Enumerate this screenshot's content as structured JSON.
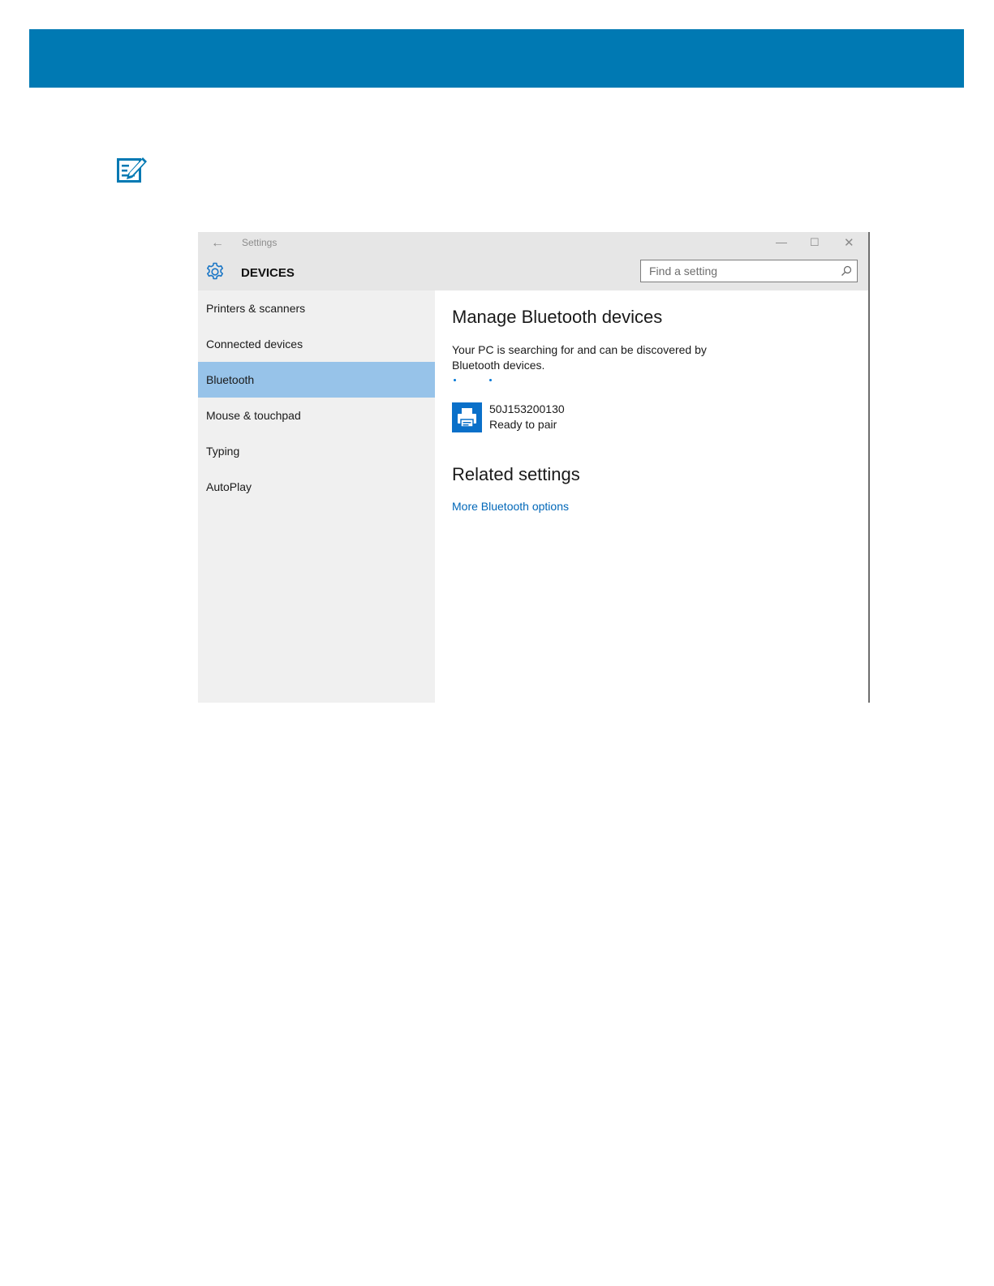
{
  "colors": {
    "header_bar": "#0079b3",
    "selected_nav": "#97c3e9",
    "link": "#0067b8",
    "sidebar_bg": "#f0f0f0",
    "titlebar_bg": "#e6e6e6"
  },
  "note": {
    "icon": "note-edit-icon"
  },
  "window": {
    "title": "Settings",
    "back_icon": "←",
    "minimize_icon": "—",
    "maximize_icon": "☐",
    "close_icon": "✕",
    "section_icon": "gear-icon",
    "section_title": "DEVICES",
    "search": {
      "placeholder": "Find a setting",
      "value": "",
      "icon": "search-icon"
    }
  },
  "sidebar": {
    "selected": "Bluetooth",
    "items": [
      {
        "label": "Printers & scanners"
      },
      {
        "label": "Connected devices"
      },
      {
        "label": "Bluetooth"
      },
      {
        "label": "Mouse & touchpad"
      },
      {
        "label": "Typing"
      },
      {
        "label": "AutoPlay"
      }
    ]
  },
  "content": {
    "heading": "Manage Bluetooth devices",
    "status": "Your PC is searching for and can be discovered by Bluetooth devices.",
    "device": {
      "icon": "printer-icon",
      "name": "50J153200130",
      "status": "Ready to pair"
    },
    "related_heading": "Related settings",
    "related_link": "More Bluetooth options"
  }
}
